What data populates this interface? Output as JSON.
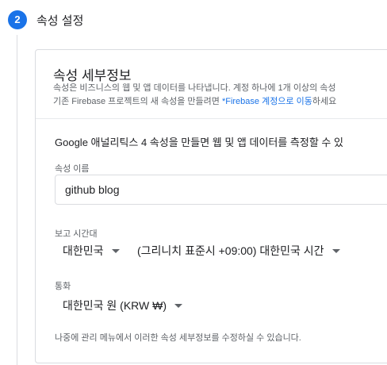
{
  "step": {
    "number": "2",
    "title": "속성 설정"
  },
  "card": {
    "title": "속성 세부정보",
    "desc_line1": "속성은 비즈니스의 웹 및 앱 데이터를 나타냅니다. 계정 하나에 1개 이상의 속성",
    "desc_line2_prefix": "기존 Firebase 프로젝트의 새 속성을 만들려면 ",
    "desc_line2_link": "*Firebase 계정으로 이동",
    "desc_line2_suffix": "하세요",
    "intro": "Google 애널리틱스 4 속성을 만들면 웹 및 앱 데이터를 측정할 수 있",
    "property_name_label": "속성 이름",
    "property_name_value": "github blog",
    "timezone_label": "보고 시간대",
    "timezone_country": "대한민국",
    "timezone_value": "(그리니치 표준시 +09:00) 대한민국 시간",
    "currency_label": "통화",
    "currency_value": "대한민국 원 (KRW ₩)",
    "footer_note": "나중에 관리 메뉴에서 이러한 속성 세부정보를 수정하실 수 있습니다."
  }
}
